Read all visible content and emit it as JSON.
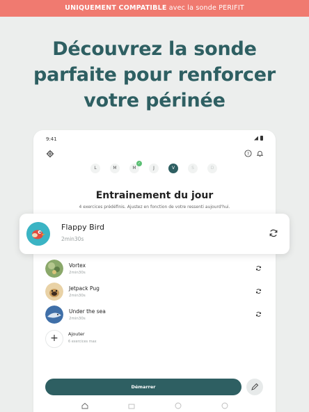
{
  "banner": {
    "strong": "UNIQUEMENT COMPATIBLE",
    "rest": " avec la sonde PERIFIT"
  },
  "headline": {
    "line1": "Découvrez la sonde",
    "line2": "parfaite pour renforcer",
    "line3": "votre périnée"
  },
  "status": {
    "time": "9:41"
  },
  "days": [
    {
      "label": "L",
      "state": "normal"
    },
    {
      "label": "M",
      "state": "normal"
    },
    {
      "label": "M",
      "state": "done"
    },
    {
      "label": "J",
      "state": "normal"
    },
    {
      "label": "V",
      "state": "active"
    },
    {
      "label": "S",
      "state": "faded"
    },
    {
      "label": "D",
      "state": "faded"
    }
  ],
  "session": {
    "title": "Entrainement du jour",
    "subtitle": "4 exercices prédéfinis. Ajustez en fonction de votre ressenti aujourd'hui."
  },
  "featured": {
    "name": "Flappy Bird",
    "duration": "2min30s"
  },
  "exercises": [
    {
      "name": "Vortex",
      "duration": "2min30s"
    },
    {
      "name": "Jetpack Pug",
      "duration": "2min30s"
    },
    {
      "name": "Under the sea",
      "duration": "2min30s"
    }
  ],
  "add": {
    "label": "Ajouter",
    "sub": "6 exercices max",
    "icon": "plus-icon"
  },
  "actions": {
    "start": "Démarrer"
  },
  "colors": {
    "primary": "#2e5f62",
    "banner": "#f07a70",
    "background": "#eceeed"
  }
}
